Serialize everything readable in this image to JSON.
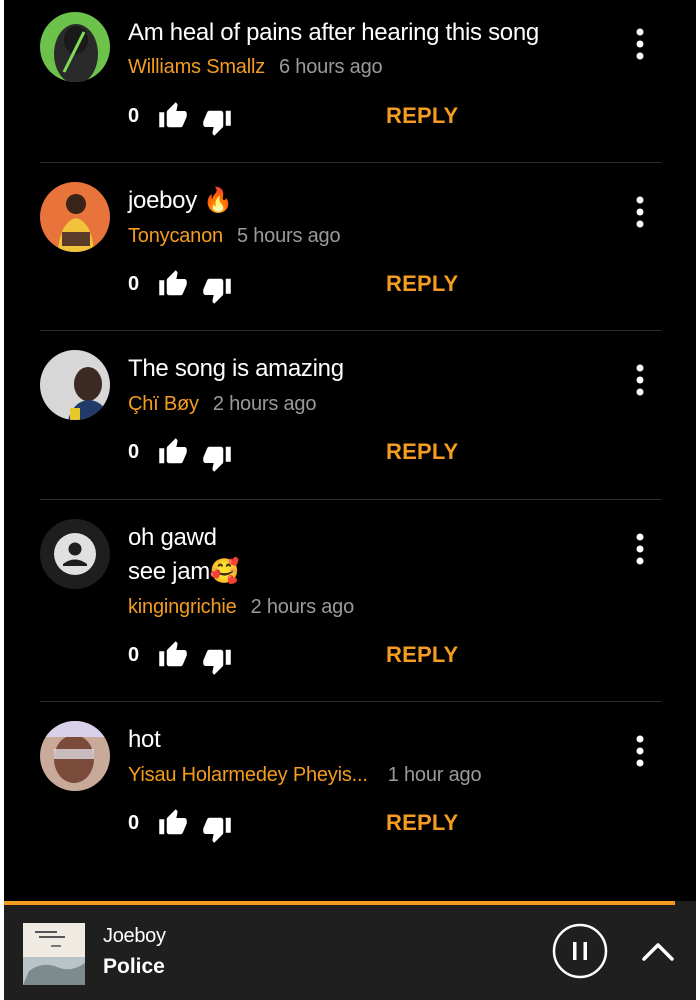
{
  "colors": {
    "background": "#000000",
    "accent": "#f39c21",
    "text": "#ffffff",
    "muted": "#9a9a9a",
    "player_background": "#1f1f1f"
  },
  "comments": [
    {
      "text_lines": [
        "Am heal of pains after hearing  this song"
      ],
      "author": "Williams Smallz",
      "time": "6 hours ago",
      "likes": "0",
      "reply_label": "REPLY"
    },
    {
      "text_lines": [
        "joeboy 🔥"
      ],
      "author": "Tonycanon",
      "time": "5 hours ago",
      "likes": "0",
      "reply_label": "REPLY"
    },
    {
      "text_lines": [
        "The song is amazing"
      ],
      "author": "Çhï Bøy",
      "time": "2 hours ago",
      "likes": "0",
      "reply_label": "REPLY"
    },
    {
      "text_lines": [
        "oh gawd",
        "see jam🥰"
      ],
      "author": "kingingrichie",
      "time": "2 hours ago",
      "likes": "0",
      "reply_label": "REPLY"
    },
    {
      "text_lines": [
        "hot"
      ],
      "author": "Yisau Holarmedey Pheyis...",
      "time": "1 hour ago",
      "likes": "0",
      "reply_label": "REPLY"
    }
  ],
  "player": {
    "artist": "Joeboy",
    "track": "Police",
    "progress": 0.97,
    "icons": {
      "play_state": "pause-icon",
      "expand": "chevron-up-icon"
    }
  }
}
